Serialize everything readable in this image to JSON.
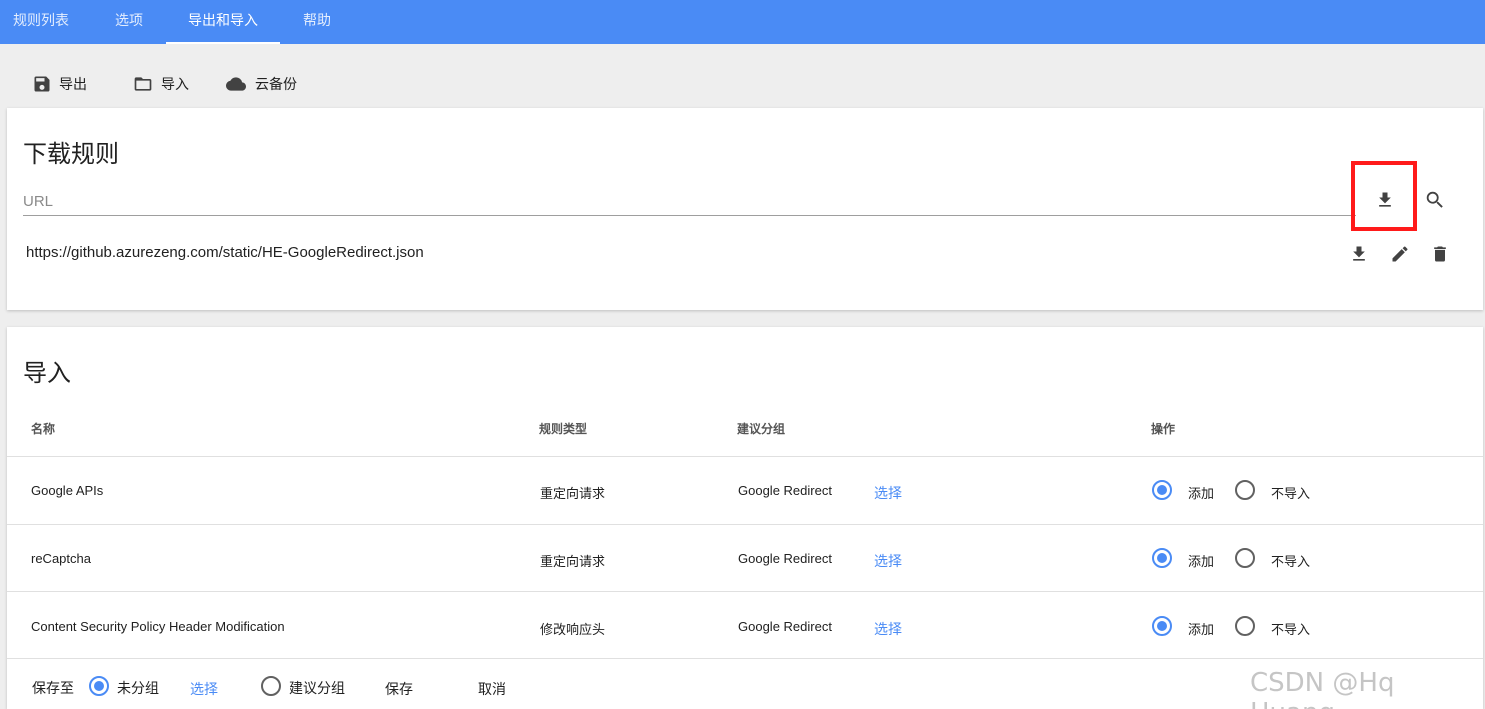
{
  "tabs": [
    "规则列表",
    "选项",
    "导出和导入",
    "帮助"
  ],
  "toolbar": {
    "export_label": "导出",
    "import_label": "导入",
    "cloud_label": "云备份"
  },
  "download": {
    "title": "下载规则",
    "url_placeholder": "URL",
    "saved_url": "https://github.azurezeng.com/static/HE-GoogleRedirect.json"
  },
  "import": {
    "title": "导入",
    "headers": {
      "name": "名称",
      "type": "规则类型",
      "group": "建议分组",
      "action": "操作"
    },
    "rows": [
      {
        "name": "Google APIs",
        "type": "重定向请求",
        "group": "Google Redirect",
        "choose": "选择",
        "add": "添加",
        "skip": "不导入"
      },
      {
        "name": "reCaptcha",
        "type": "重定向请求",
        "group": "Google Redirect",
        "choose": "选择",
        "add": "添加",
        "skip": "不导入"
      },
      {
        "name": "Content Security Policy Header Modification",
        "type": "修改响应头",
        "group": "Google Redirect",
        "choose": "选择",
        "add": "添加",
        "skip": "不导入"
      }
    ],
    "footer": {
      "save_to": "保存至",
      "ungrouped": "未分组",
      "choose": "选择",
      "suggested": "建议分组",
      "save": "保存",
      "cancel": "取消"
    }
  },
  "watermark": "CSDN @Hq Huang",
  "colors": {
    "accent": "#4a8bf5",
    "highlight": "#ff1a1a"
  }
}
